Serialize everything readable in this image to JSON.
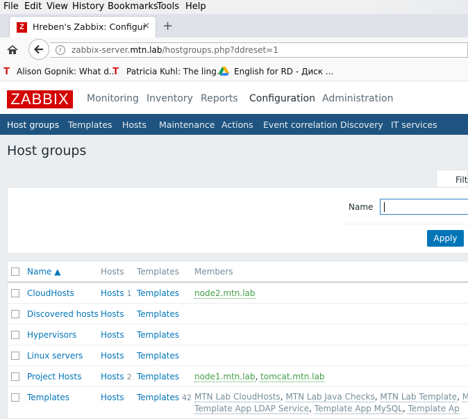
{
  "browser": {
    "menu": [
      "File",
      "Edit",
      "View",
      "History",
      "Bookmarks",
      "Tools",
      "Help"
    ],
    "tab_title": "Hreben's Zabbix: Configur...",
    "tab_close": "×",
    "new_tab": "+",
    "url_prefix": "zabbix-server.",
    "url_host": "mtn.lab",
    "url_path": "/hostgroups.php?ddreset=1",
    "bookmarks": [
      {
        "label": "Alison Gopnik: What d...",
        "icon": "ted-icon"
      },
      {
        "label": "Patricia Kuhl: The ling...",
        "icon": "ted-icon"
      },
      {
        "label": "English for RD - Диск ...",
        "icon": "google-drive-icon"
      }
    ]
  },
  "zabbix": {
    "logo": "ZABBIX",
    "main_nav": [
      "Monitoring",
      "Inventory",
      "Reports",
      "Configuration",
      "Administration"
    ],
    "active_main": "Configuration",
    "sub_nav": [
      "Host groups",
      "Templates",
      "Hosts",
      "Maintenance",
      "Actions",
      "Event correlation",
      "Discovery",
      "IT services"
    ],
    "active_sub": "Host groups",
    "page_title": "Host groups",
    "filter": {
      "tab_label": "Filter",
      "name_label": "Name",
      "name_value": "",
      "apply_label": "Apply"
    },
    "table": {
      "headers": {
        "name": "Name ▲",
        "hosts": "Hosts",
        "templates": "Templates",
        "members": "Members"
      },
      "rows": [
        {
          "name": "CloudHosts",
          "hosts": "Hosts",
          "hosts_count": "1",
          "templates": "Templates",
          "templates_count": "",
          "members": "node2.mtn.lab",
          "members_2": "",
          "member_color": "green"
        },
        {
          "name": "Discovered hosts",
          "hosts": "Hosts",
          "hosts_count": "",
          "templates": "Templates",
          "templates_count": "",
          "members": "",
          "members_2": "",
          "member_color": "green"
        },
        {
          "name": "Hypervisors",
          "hosts": "Hosts",
          "hosts_count": "",
          "templates": "Templates",
          "templates_count": "",
          "members": "",
          "members_2": "",
          "member_color": "green"
        },
        {
          "name": "Linux servers",
          "hosts": "Hosts",
          "hosts_count": "",
          "templates": "Templates",
          "templates_count": "",
          "members": "",
          "members_2": "",
          "member_color": "green"
        },
        {
          "name": "Project Hosts",
          "hosts": "Hosts",
          "hosts_count": "2",
          "templates": "Templates",
          "templates_count": "",
          "members": "node1.mtn.lab",
          "members_2": "tomcat.mtn.lab",
          "member_color": "green"
        },
        {
          "name": "Templates",
          "hosts": "Hosts",
          "hosts_count": "",
          "templates": "Templates",
          "templates_count": "42",
          "members": "",
          "members_2": "",
          "member_color": "grey"
        }
      ],
      "templates_members_line1": [
        "MTN Lab CloudHosts",
        "MTN Lab Java Checks",
        "MTN Lab Template",
        "MTN L"
      ],
      "templates_members_line2": [
        "Template App LDAP Service",
        "Template App MySQL",
        "Template Ap"
      ]
    }
  },
  "colors": {
    "brand_red": "#d40000",
    "subnav_bg": "#1f5480",
    "link_blue": "#0275b8",
    "member_green": "#429e47",
    "apply_bg": "#0275b8"
  }
}
